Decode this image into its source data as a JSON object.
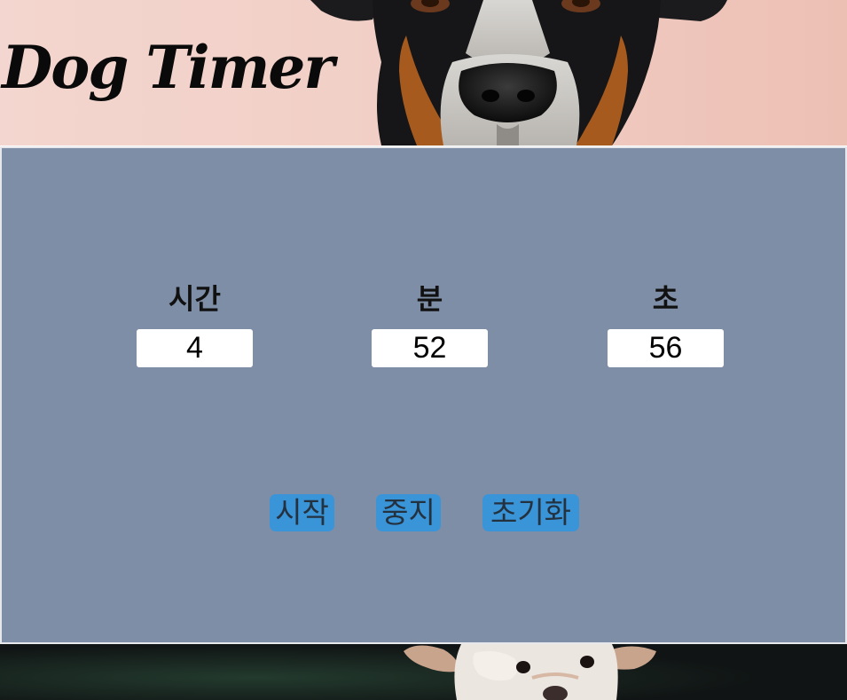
{
  "header": {
    "title": "Dog Timer"
  },
  "timer": {
    "hours": {
      "label": "시간",
      "value": "4"
    },
    "minutes": {
      "label": "분",
      "value": "52"
    },
    "seconds": {
      "label": "초",
      "value": "56"
    }
  },
  "controls": {
    "start_label": "시작",
    "stop_label": "중지",
    "reset_label": "초기화"
  },
  "colors": {
    "panel_background": "#7e8ea6",
    "button_background": "#3a94d8",
    "button_text": "#24313f",
    "header_background": "#f1cfc6"
  },
  "images": {
    "header_photo": "dog-photo-banner",
    "footer_photo": "white-dog-photo"
  }
}
